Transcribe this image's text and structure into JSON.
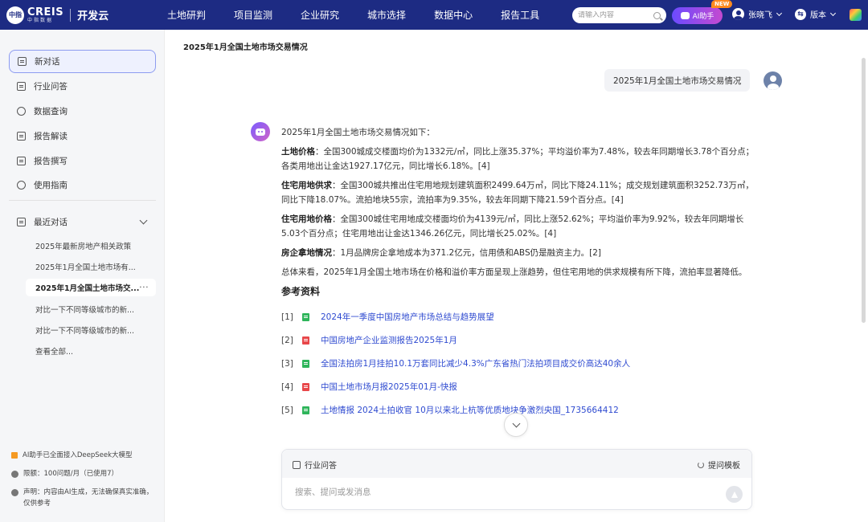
{
  "header": {
    "logo_mark": "中指",
    "logo_name": "CREIS",
    "logo_sub": "中指数据",
    "product": "开发云",
    "nav": [
      "土地研判",
      "项目监测",
      "企业研究",
      "城市选择",
      "数据中心",
      "报告工具"
    ],
    "search_placeholder": "请输入内容",
    "ai_button": "AI助手",
    "new_badge": "NEW",
    "user_name": "张晓飞",
    "version_label": "版本",
    "version_icon": "⇆"
  },
  "sidebar": {
    "items": [
      {
        "label": "新对话",
        "icon": "chat-icon"
      },
      {
        "label": "行业问答",
        "icon": "document-icon"
      },
      {
        "label": "数据查询",
        "icon": "database-icon"
      },
      {
        "label": "报告解读",
        "icon": "report-icon"
      },
      {
        "label": "报告撰写",
        "icon": "write-icon"
      },
      {
        "label": "使用指南",
        "icon": "compass-icon"
      }
    ],
    "recent_title": "最近对话",
    "recent": [
      "2025年最新房地产相关政策",
      "2025年1月全国土地市场有...",
      "2025年1月全国土地市场交...",
      "对比一下不同等级城市的新...",
      "对比一下不同等级城市的新...",
      "查看全部..."
    ],
    "recent_more": "···",
    "footer": [
      "AI助手已全面接入DeepSeek大模型",
      "限额：100问题/月（已使用7）",
      "声明：内容由AI生成，无法确保真实准确，仅供参考"
    ]
  },
  "main": {
    "page_title": "2025年1月全国土地市场交易情况",
    "user_message": "2025年1月全国土地市场交易情况",
    "answer": {
      "intro": "2025年1月全国土地市场交易情况如下：",
      "sections": [
        {
          "label": "土地价格",
          "text": "：全国300城成交楼面均价为1332元/㎡，同比上涨35.37%；平均溢价率为7.48%，较去年同期增长3.78个百分点；各类用地出让金达1927.17亿元，同比增长6.18%。[4]"
        },
        {
          "label": "住宅用地供求",
          "text": "：全国300城共推出住宅用地规划建筑面积2499.64万㎡，同比下降24.11%；成交规划建筑面积3252.73万㎡，同比下降18.07%。流拍地块55宗，流拍率为9.35%，较去年同期下降21.59个百分点。[4]"
        },
        {
          "label": "住宅用地价格",
          "text": "：全国300城住宅用地成交楼面均价为4139元/㎡，同比上涨52.62%；平均溢价率为9.92%，较去年同期增长5.03个百分点；住宅用地出让金达1346.26亿元，同比增长25.02%。[4]"
        },
        {
          "label": "房企拿地情况",
          "text": "：1月品牌房企拿地成本为371.2亿元，信用债和ABS仍是融资主力。[2]"
        }
      ],
      "summary": "总体来看，2025年1月全国土地市场在价格和溢价率方面呈现上涨趋势，但住宅用地的供求规模有所下降，流拍率显著降低。"
    },
    "references_title": "参考资料",
    "references": [
      {
        "idx": "[1]",
        "color": "green",
        "title": "2024年一季度中国房地产市场总结与趋势展望"
      },
      {
        "idx": "[2]",
        "color": "red",
        "title": "中国房地产企业监测报告2025年1月"
      },
      {
        "idx": "[3]",
        "color": "green",
        "title": "全国法拍房1月挂拍10.1万套同比减少4.3%广东省热门法拍项目成交价高达40余人"
      },
      {
        "idx": "[4]",
        "color": "red",
        "title": "中国土地市场月报2025年01月-快报"
      },
      {
        "idx": "[5]",
        "color": "green",
        "title": "土地情报 2024土拍收官 10月以来北上杭等优质地块争激烈央国_1735664412"
      }
    ],
    "composer": {
      "tag": "行业问答",
      "template_label": "提问模板",
      "placeholder": "搜索、提问或发消息",
      "send_glyph": "A"
    }
  },
  "colors": {
    "nav_bg": "#1d2b83",
    "link": "#2f4bd0",
    "active_border": "#8d9cf0"
  }
}
